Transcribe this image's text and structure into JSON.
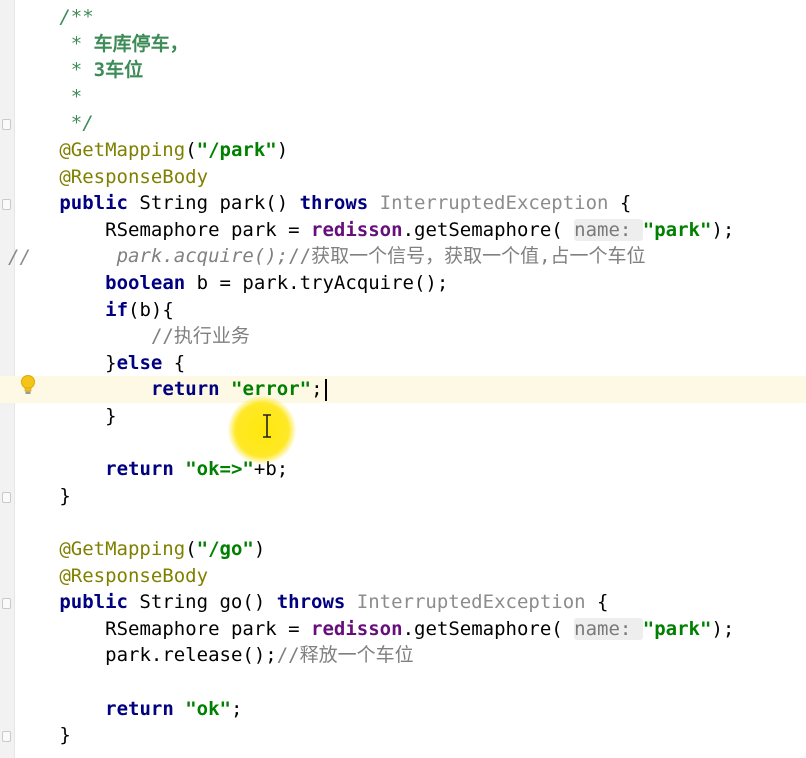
{
  "editor": {
    "lines": [
      {
        "indent": 3,
        "tokens": [
          {
            "t": "jd",
            "v": "/**"
          }
        ]
      },
      {
        "indent": 3,
        "tokens": [
          {
            "t": "jd",
            "v": " * "
          },
          {
            "t": "jdc",
            "v": "车库停车，"
          }
        ]
      },
      {
        "indent": 3,
        "tokens": [
          {
            "t": "jd",
            "v": " * "
          },
          {
            "t": "jdc",
            "v": "3车位"
          }
        ]
      },
      {
        "indent": 3,
        "tokens": [
          {
            "t": "jd",
            "v": " *"
          }
        ]
      },
      {
        "indent": 3,
        "tokens": [
          {
            "t": "jd",
            "v": " */"
          }
        ]
      },
      {
        "indent": 3,
        "tokens": [
          {
            "t": "an",
            "v": "@GetMapping"
          },
          {
            "t": "def",
            "v": "("
          },
          {
            "t": "str",
            "v": "\"/park\""
          },
          {
            "t": "def",
            "v": ")"
          }
        ]
      },
      {
        "indent": 3,
        "tokens": [
          {
            "t": "an",
            "v": "@ResponseBody"
          }
        ]
      },
      {
        "indent": 3,
        "tokens": [
          {
            "t": "kw",
            "v": "public"
          },
          {
            "t": "def",
            "v": " String park() "
          },
          {
            "t": "kw",
            "v": "throws"
          },
          {
            "t": "def",
            "v": " "
          },
          {
            "t": "ex",
            "v": "InterruptedException"
          },
          {
            "t": "def",
            "v": " {"
          }
        ]
      },
      {
        "indent": 7,
        "tokens": [
          {
            "t": "def",
            "v": "RSemaphore park = "
          },
          {
            "t": "fld",
            "v": "redisson"
          },
          {
            "t": "def",
            "v": ".getSemaphore( "
          },
          {
            "t": "hint",
            "v": "name: "
          },
          {
            "t": "str",
            "v": "\"park\""
          },
          {
            "t": "def",
            "v": ");"
          }
        ]
      },
      {
        "indent": 8,
        "tokens": [
          {
            "t": "cm",
            "v": "park.acquire();"
          },
          {
            "t": "cc",
            "v": "//获取一个信号，获取一个值,占一个车位"
          }
        ]
      },
      {
        "indent": 7,
        "tokens": [
          {
            "t": "kw",
            "v": "boolean"
          },
          {
            "t": "def",
            "v": " b = park.tryAcquire();"
          }
        ]
      },
      {
        "indent": 7,
        "tokens": [
          {
            "t": "kw",
            "v": "if"
          },
          {
            "t": "def",
            "v": "(b){"
          }
        ]
      },
      {
        "indent": 11,
        "tokens": [
          {
            "t": "cc",
            "v": "//执行业务"
          }
        ]
      },
      {
        "indent": 7,
        "tokens": [
          {
            "t": "def",
            "v": "}"
          },
          {
            "t": "kw",
            "v": "else"
          },
          {
            "t": "def",
            "v": " {"
          }
        ]
      },
      {
        "indent": 11,
        "tokens": [
          {
            "t": "kw",
            "v": "return"
          },
          {
            "t": "def",
            "v": " "
          },
          {
            "t": "str",
            "v": "\"error\""
          },
          {
            "t": "def",
            "v": ";"
          }
        ]
      },
      {
        "indent": 7,
        "tokens": [
          {
            "t": "def",
            "v": "}"
          }
        ]
      },
      {
        "indent": 0,
        "tokens": []
      },
      {
        "indent": 7,
        "tokens": [
          {
            "t": "kw",
            "v": "return"
          },
          {
            "t": "def",
            "v": " "
          },
          {
            "t": "str",
            "v": "\"ok=>\""
          },
          {
            "t": "def",
            "v": "+b;"
          }
        ]
      },
      {
        "indent": 3,
        "tokens": [
          {
            "t": "def",
            "v": "}"
          }
        ]
      },
      {
        "indent": 0,
        "tokens": []
      },
      {
        "indent": 3,
        "tokens": [
          {
            "t": "an",
            "v": "@GetMapping"
          },
          {
            "t": "def",
            "v": "("
          },
          {
            "t": "str",
            "v": "\"/go\""
          },
          {
            "t": "def",
            "v": ")"
          }
        ]
      },
      {
        "indent": 3,
        "tokens": [
          {
            "t": "an",
            "v": "@ResponseBody"
          }
        ]
      },
      {
        "indent": 3,
        "tokens": [
          {
            "t": "kw",
            "v": "public"
          },
          {
            "t": "def",
            "v": " String go() "
          },
          {
            "t": "kw",
            "v": "throws"
          },
          {
            "t": "def",
            "v": " "
          },
          {
            "t": "ex",
            "v": "InterruptedException"
          },
          {
            "t": "def",
            "v": " {"
          }
        ]
      },
      {
        "indent": 7,
        "tokens": [
          {
            "t": "def",
            "v": "RSemaphore park = "
          },
          {
            "t": "fld",
            "v": "redisson"
          },
          {
            "t": "def",
            "v": ".getSemaphore( "
          },
          {
            "t": "hint",
            "v": "name: "
          },
          {
            "t": "str",
            "v": "\"park\""
          },
          {
            "t": "def",
            "v": ");"
          }
        ]
      },
      {
        "indent": 7,
        "tokens": [
          {
            "t": "def",
            "v": "park.release();"
          },
          {
            "t": "cc",
            "v": "//释放一个车位"
          }
        ]
      },
      {
        "indent": 0,
        "tokens": []
      },
      {
        "indent": 7,
        "tokens": [
          {
            "t": "kw",
            "v": "return"
          },
          {
            "t": "def",
            "v": " "
          },
          {
            "t": "str",
            "v": "\"ok\""
          },
          {
            "t": "def",
            "v": ";"
          }
        ]
      },
      {
        "indent": 3,
        "tokens": [
          {
            "t": "def",
            "v": "}"
          }
        ]
      }
    ],
    "line_comment_marker": "//",
    "highlighted_line_index": 14,
    "bulb_line_index": 14
  }
}
